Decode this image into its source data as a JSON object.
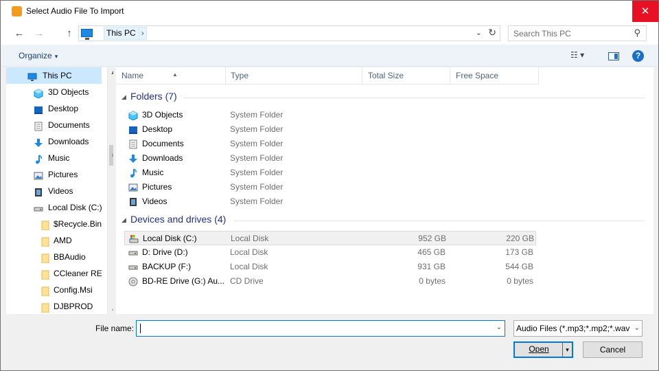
{
  "window": {
    "title": "Select Audio File To Import",
    "close": "✕"
  },
  "address": {
    "crumb": "This PC",
    "separator": "›",
    "dropdown": "⌄",
    "refresh": "↻"
  },
  "nav_buttons": {
    "back": "←",
    "forward": "→",
    "up": "↑"
  },
  "search": {
    "placeholder": "Search This PC",
    "icon": "⚲"
  },
  "toolbar": {
    "organize": "Organize",
    "organize_caret": "▾",
    "view": "☷ ▾",
    "help": "?"
  },
  "sidebar": {
    "items": [
      {
        "label": "This PC",
        "icon": "pc-icon"
      },
      {
        "label": "3D Objects",
        "icon": "3d-objects-icon"
      },
      {
        "label": "Desktop",
        "icon": "desktop-icon"
      },
      {
        "label": "Documents",
        "icon": "documents-icon"
      },
      {
        "label": "Downloads",
        "icon": "downloads-icon"
      },
      {
        "label": "Music",
        "icon": "music-icon"
      },
      {
        "label": "Pictures",
        "icon": "pictures-icon"
      },
      {
        "label": "Videos",
        "icon": "videos-icon"
      },
      {
        "label": "Local Disk (C:)",
        "icon": "drive-icon"
      },
      {
        "label": "$Recycle.Bin",
        "icon": "folder-icon"
      },
      {
        "label": "AMD",
        "icon": "folder-icon"
      },
      {
        "label": "BBAudio",
        "icon": "folder-icon"
      },
      {
        "label": "CCleaner REG",
        "icon": "folder-icon"
      },
      {
        "label": "Config.Msi",
        "icon": "folder-icon"
      },
      {
        "label": "DJBPROD",
        "icon": "folder-icon"
      }
    ],
    "scroll_up": "▲",
    "scroll_down": "⌄",
    "scroll_grip": "≡"
  },
  "columns": {
    "name": "Name",
    "type": "Type",
    "total_size": "Total Size",
    "free_space": "Free Space",
    "sort_caret": "▲"
  },
  "groups": {
    "folders": {
      "title": "Folders (7)",
      "caret": "◢",
      "rows": [
        {
          "name": "3D Objects",
          "type": "System Folder",
          "icon": "3d-objects-icon"
        },
        {
          "name": "Desktop",
          "type": "System Folder",
          "icon": "desktop-icon"
        },
        {
          "name": "Documents",
          "type": "System Folder",
          "icon": "documents-icon"
        },
        {
          "name": "Downloads",
          "type": "System Folder",
          "icon": "downloads-icon"
        },
        {
          "name": "Music",
          "type": "System Folder",
          "icon": "music-icon"
        },
        {
          "name": "Pictures",
          "type": "System Folder",
          "icon": "pictures-icon"
        },
        {
          "name": "Videos",
          "type": "System Folder",
          "icon": "videos-icon"
        }
      ]
    },
    "devices": {
      "title": "Devices and drives (4)",
      "caret": "◢",
      "rows": [
        {
          "name": "Local Disk (C:)",
          "type": "Local Disk",
          "total": "952 GB",
          "free": "220 GB",
          "icon": "system-drive-icon"
        },
        {
          "name": "D: Drive (D:)",
          "type": "Local Disk",
          "total": "465 GB",
          "free": "173 GB",
          "icon": "drive-icon"
        },
        {
          "name": "BACKUP (F:)",
          "type": "Local Disk",
          "total": "931 GB",
          "free": "544 GB",
          "icon": "drive-icon"
        },
        {
          "name": "BD-RE Drive (G:) Au...",
          "type": "CD Drive",
          "total": "0 bytes",
          "free": "0 bytes",
          "icon": "cd-drive-icon"
        }
      ]
    }
  },
  "footer": {
    "filename_label": "File name:",
    "filename_value": "",
    "dropdown": "⌄",
    "filter": "Audio Files (*.mp3;*.mp2;*.wav",
    "open": "Open",
    "open_split": "▾",
    "cancel": "Cancel"
  }
}
